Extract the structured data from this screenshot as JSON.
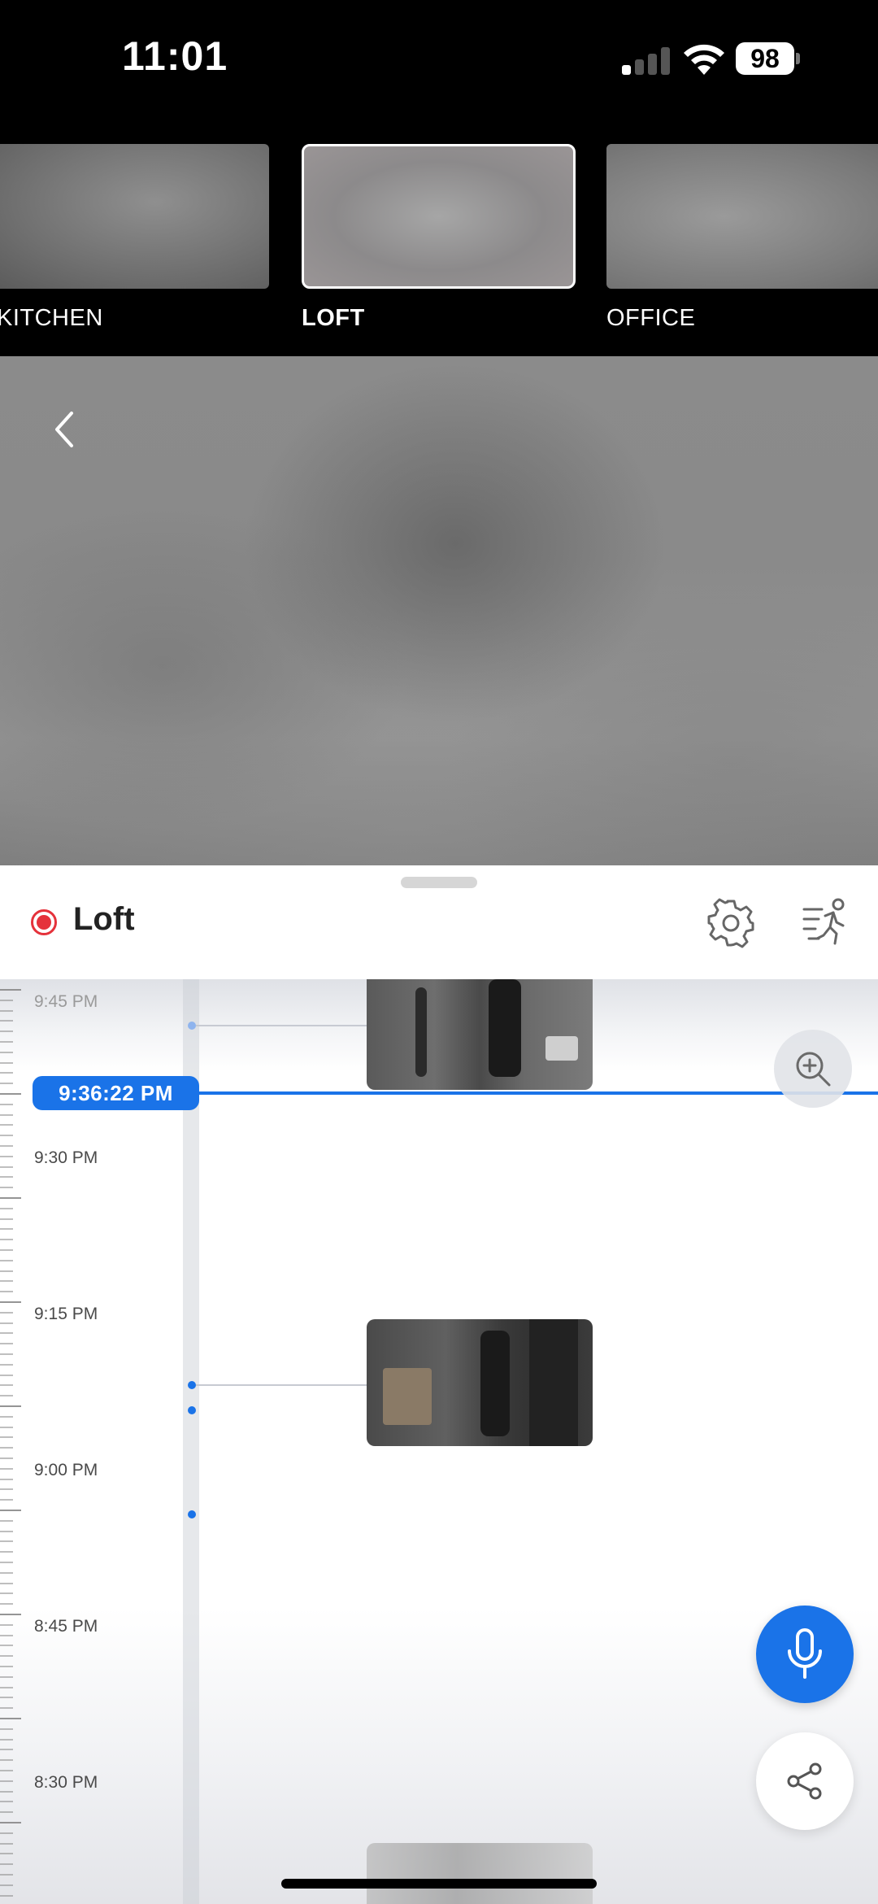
{
  "status_bar": {
    "time": "11:01",
    "battery": "98",
    "signal_icon": "cellular-signal-icon",
    "wifi_icon": "wifi-icon"
  },
  "camera_strip": {
    "items": [
      {
        "label": "KITCHEN",
        "selected": false
      },
      {
        "label": "LOFT",
        "selected": true
      },
      {
        "label": "OFFICE",
        "selected": false
      }
    ]
  },
  "live_view": {
    "back_icon": "chevron-left-icon"
  },
  "sheet": {
    "camera_name": "Loft",
    "recording_color": "#e5323b",
    "settings_icon": "gear-icon",
    "motion_icon": "motion-running-icon"
  },
  "timeline": {
    "playhead_time": "9:36:22 PM",
    "accent_color": "#1a73e8",
    "labels": [
      "9:45 PM",
      "9:30 PM",
      "9:15 PM",
      "9:00 PM",
      "8:45 PM",
      "8:30 PM"
    ],
    "zoom_icon": "zoom-in-icon",
    "mic_icon": "microphone-icon",
    "share_icon": "share-icon"
  }
}
